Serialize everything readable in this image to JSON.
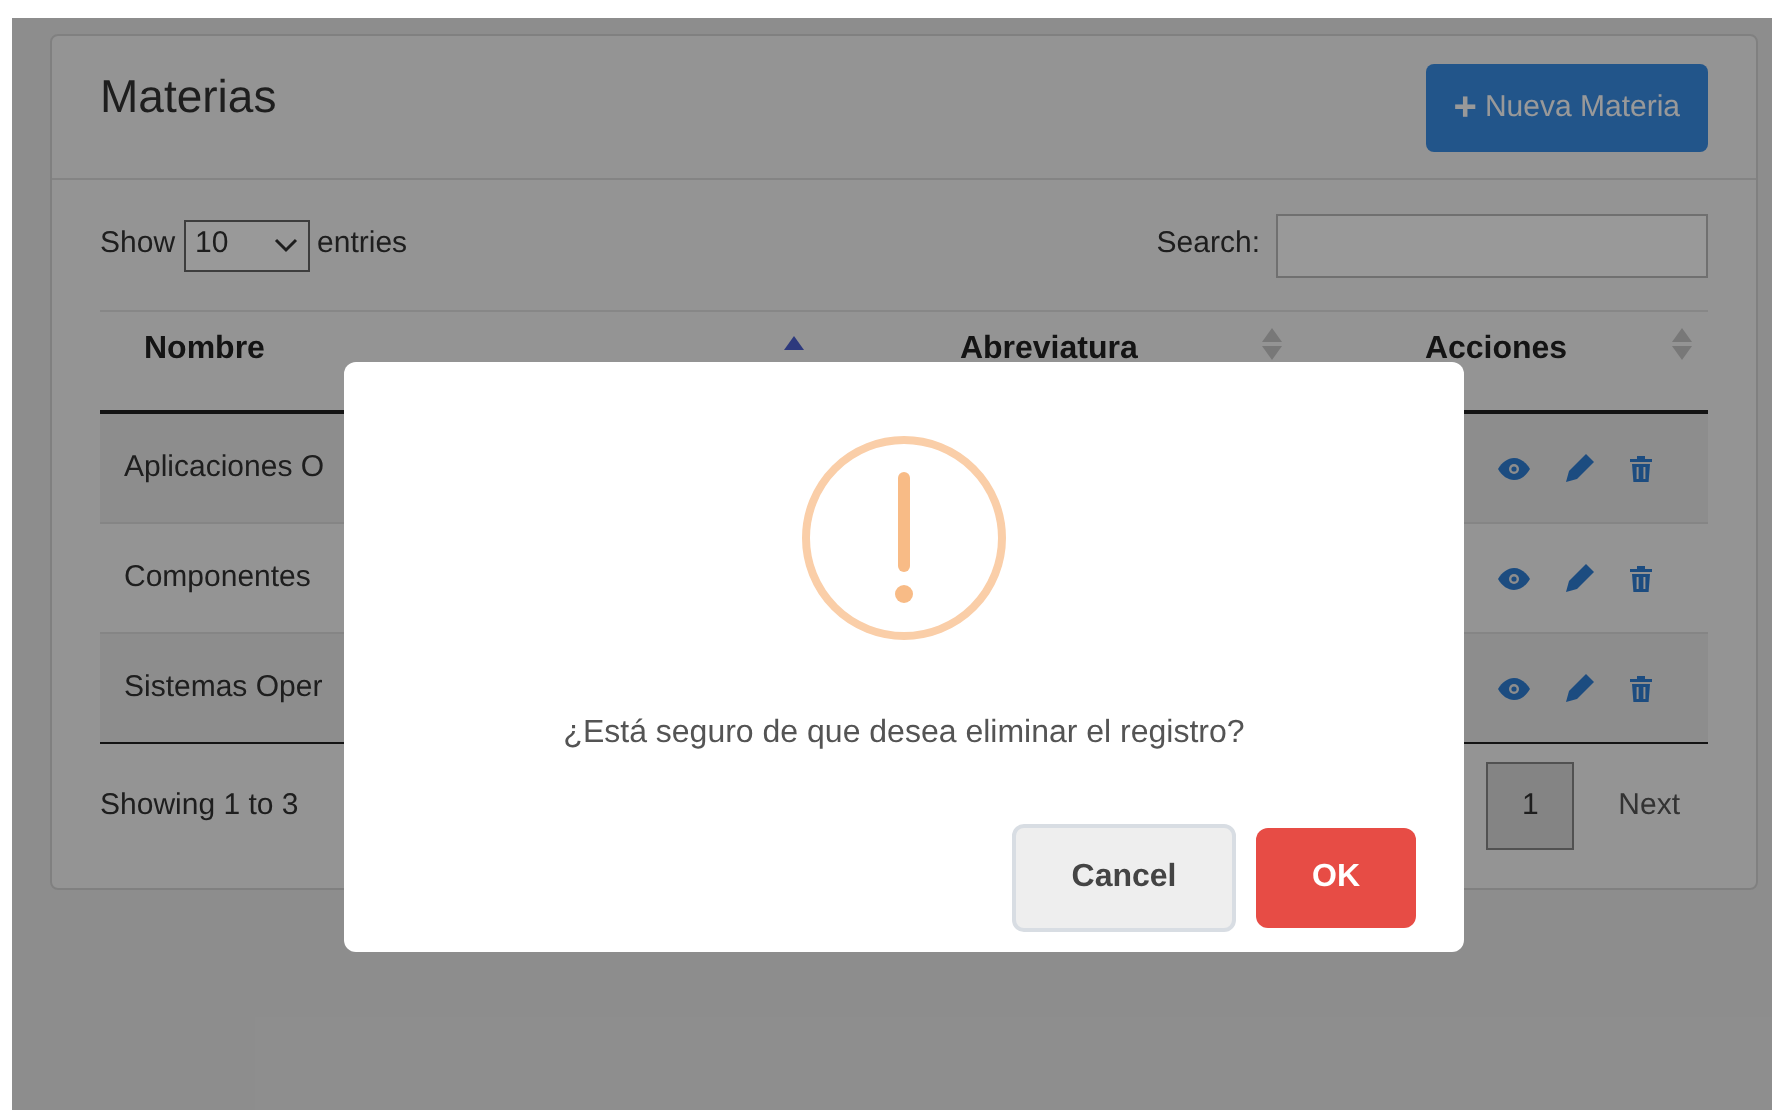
{
  "card": {
    "title": "Materias",
    "new_button": {
      "icon": "+",
      "label": "Nueva Materia"
    }
  },
  "length": {
    "prefix": "Show",
    "value": "10",
    "suffix": "entries"
  },
  "search": {
    "label": "Search:"
  },
  "table": {
    "columns": [
      {
        "label": "Nombre",
        "selected": true
      },
      {
        "label": "Abreviatura",
        "selected": false
      },
      {
        "label": "Acciones",
        "selected": false
      }
    ],
    "rows": [
      {
        "name": "Aplicaciones O"
      },
      {
        "name": "Componentes"
      },
      {
        "name": "Sistemas Oper"
      }
    ]
  },
  "info": "Showing 1 to 3",
  "pagination": {
    "pages": [
      {
        "label": "1",
        "selected": true
      }
    ],
    "next": "Next"
  },
  "dialog": {
    "message": "¿Está seguro de que desea eliminar el registro?",
    "buttons": [
      {
        "kind": "cancel",
        "label": "Cancel"
      },
      {
        "kind": "confirm",
        "label": "OK"
      }
    ]
  }
}
